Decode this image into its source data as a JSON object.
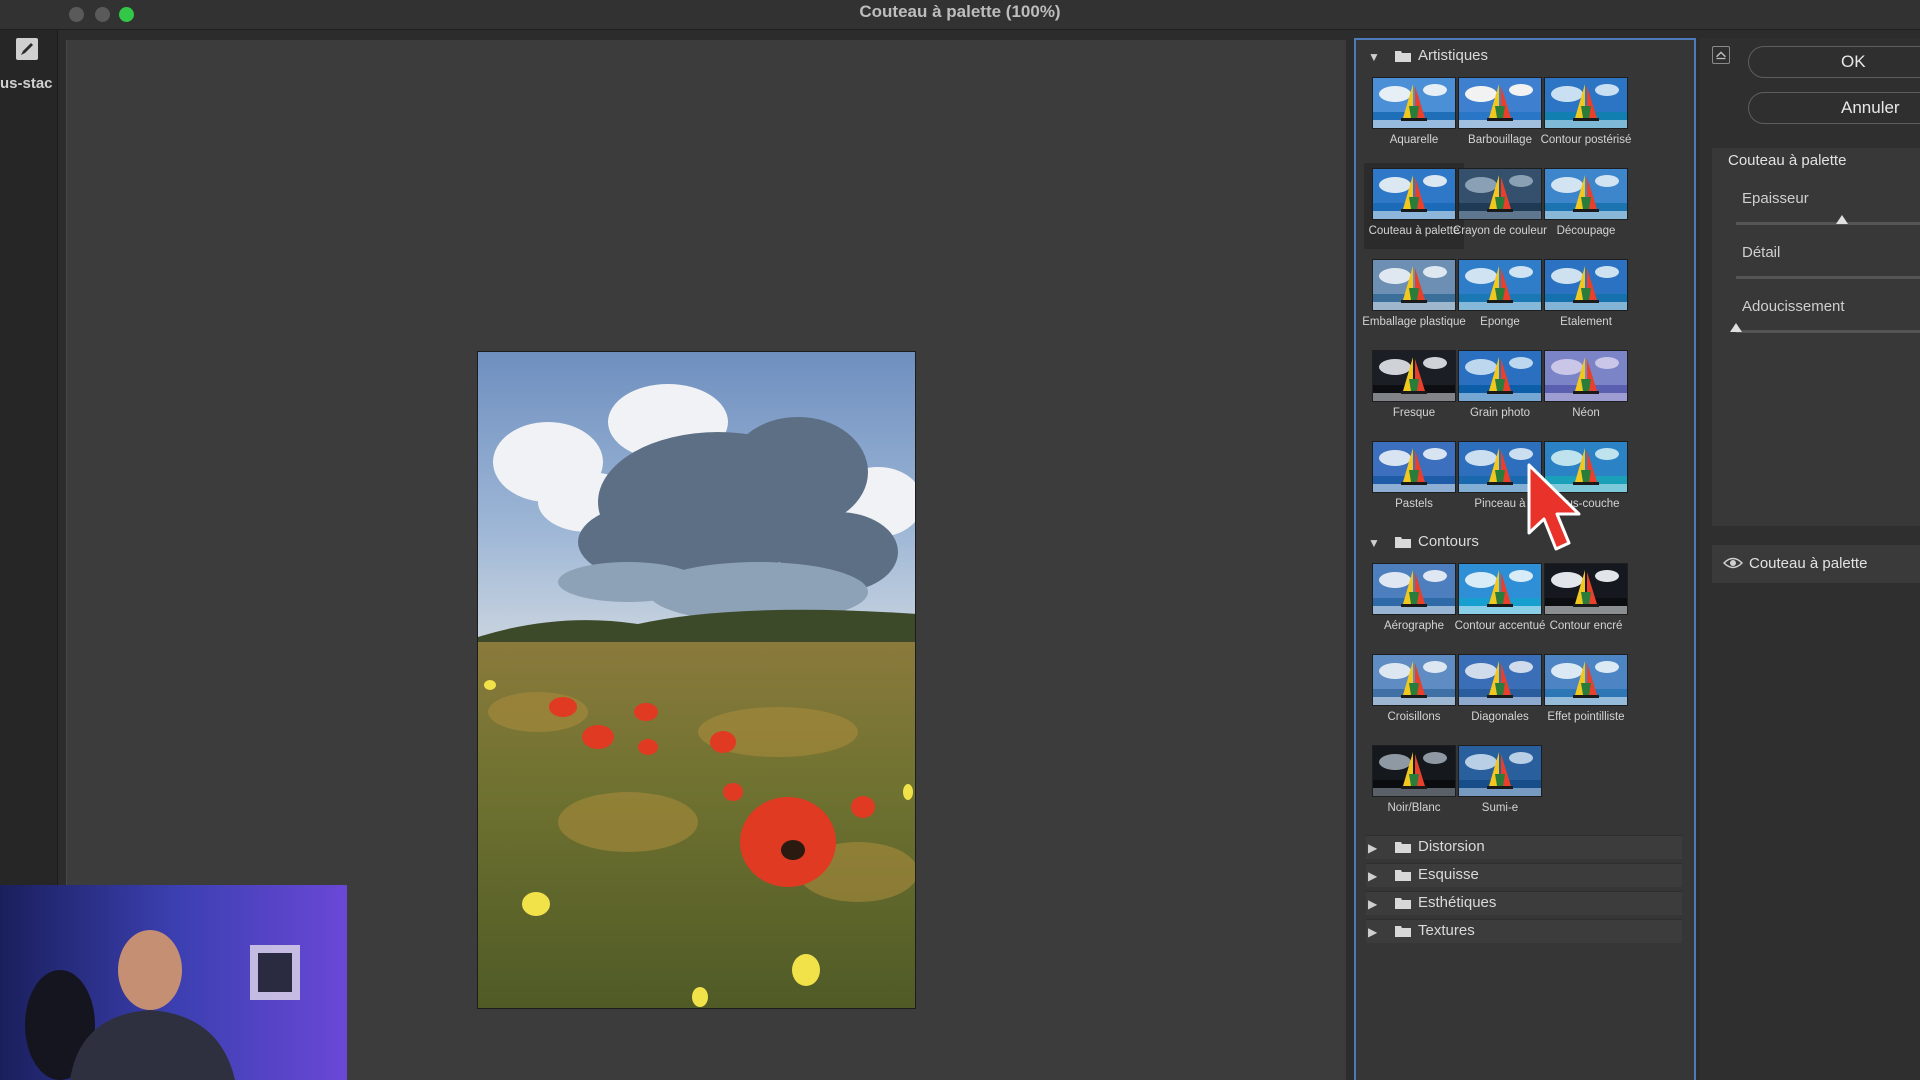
{
  "window": {
    "title": "Couteau à palette (100%)",
    "left_tab_label": "us-stac"
  },
  "gallery": {
    "categories": [
      {
        "name": "Artistiques",
        "expanded": true,
        "filters": [
          "Aquarelle",
          "Barbouillage",
          "Contour postérisé",
          "Couteau à palette",
          "Crayon de couleur",
          "Découpage",
          "Emballage plastique",
          "Eponge",
          "Etalement",
          "Fresque",
          "Grain photo",
          "Néon",
          "Pastels",
          "Pinceau à",
          "Sous-couche"
        ],
        "selected": "Couteau à palette"
      },
      {
        "name": "Contours",
        "expanded": true,
        "filters": [
          "Aérographe",
          "Contour accentué",
          "Contour encré",
          "Croisillons",
          "Diagonales",
          "Effet pointilliste",
          "Noir/Blanc",
          "Sumi-e"
        ]
      },
      {
        "name": "Distorsion",
        "expanded": false
      },
      {
        "name": "Esquisse",
        "expanded": false
      },
      {
        "name": "Esthétiques",
        "expanded": false
      },
      {
        "name": "Textures",
        "expanded": false
      }
    ]
  },
  "settings": {
    "ok_label": "OK",
    "cancel_label": "Annuler",
    "filter_name": "Couteau à palette",
    "params": [
      {
        "label": "Epaisseur",
        "value_fraction": 0.56
      },
      {
        "label": "Détail",
        "value_fraction": null
      },
      {
        "label": "Adoucissement",
        "value_fraction": 0.0
      }
    ]
  },
  "layers": [
    {
      "name": "Couteau à palette",
      "visible": true
    }
  ],
  "colors": {
    "accent": "#4d7ab8",
    "close": "#5a5a5a",
    "minimize": "#5a5a5a",
    "zoom": "#33c748",
    "cursor": "#e8322a"
  },
  "icons": {
    "collapse": "collapse-panel-icon",
    "eye": "eye-icon",
    "folder": "folder-icon",
    "disclosure_open": "triangle-down-icon",
    "disclosure_closed": "triangle-right-icon"
  }
}
